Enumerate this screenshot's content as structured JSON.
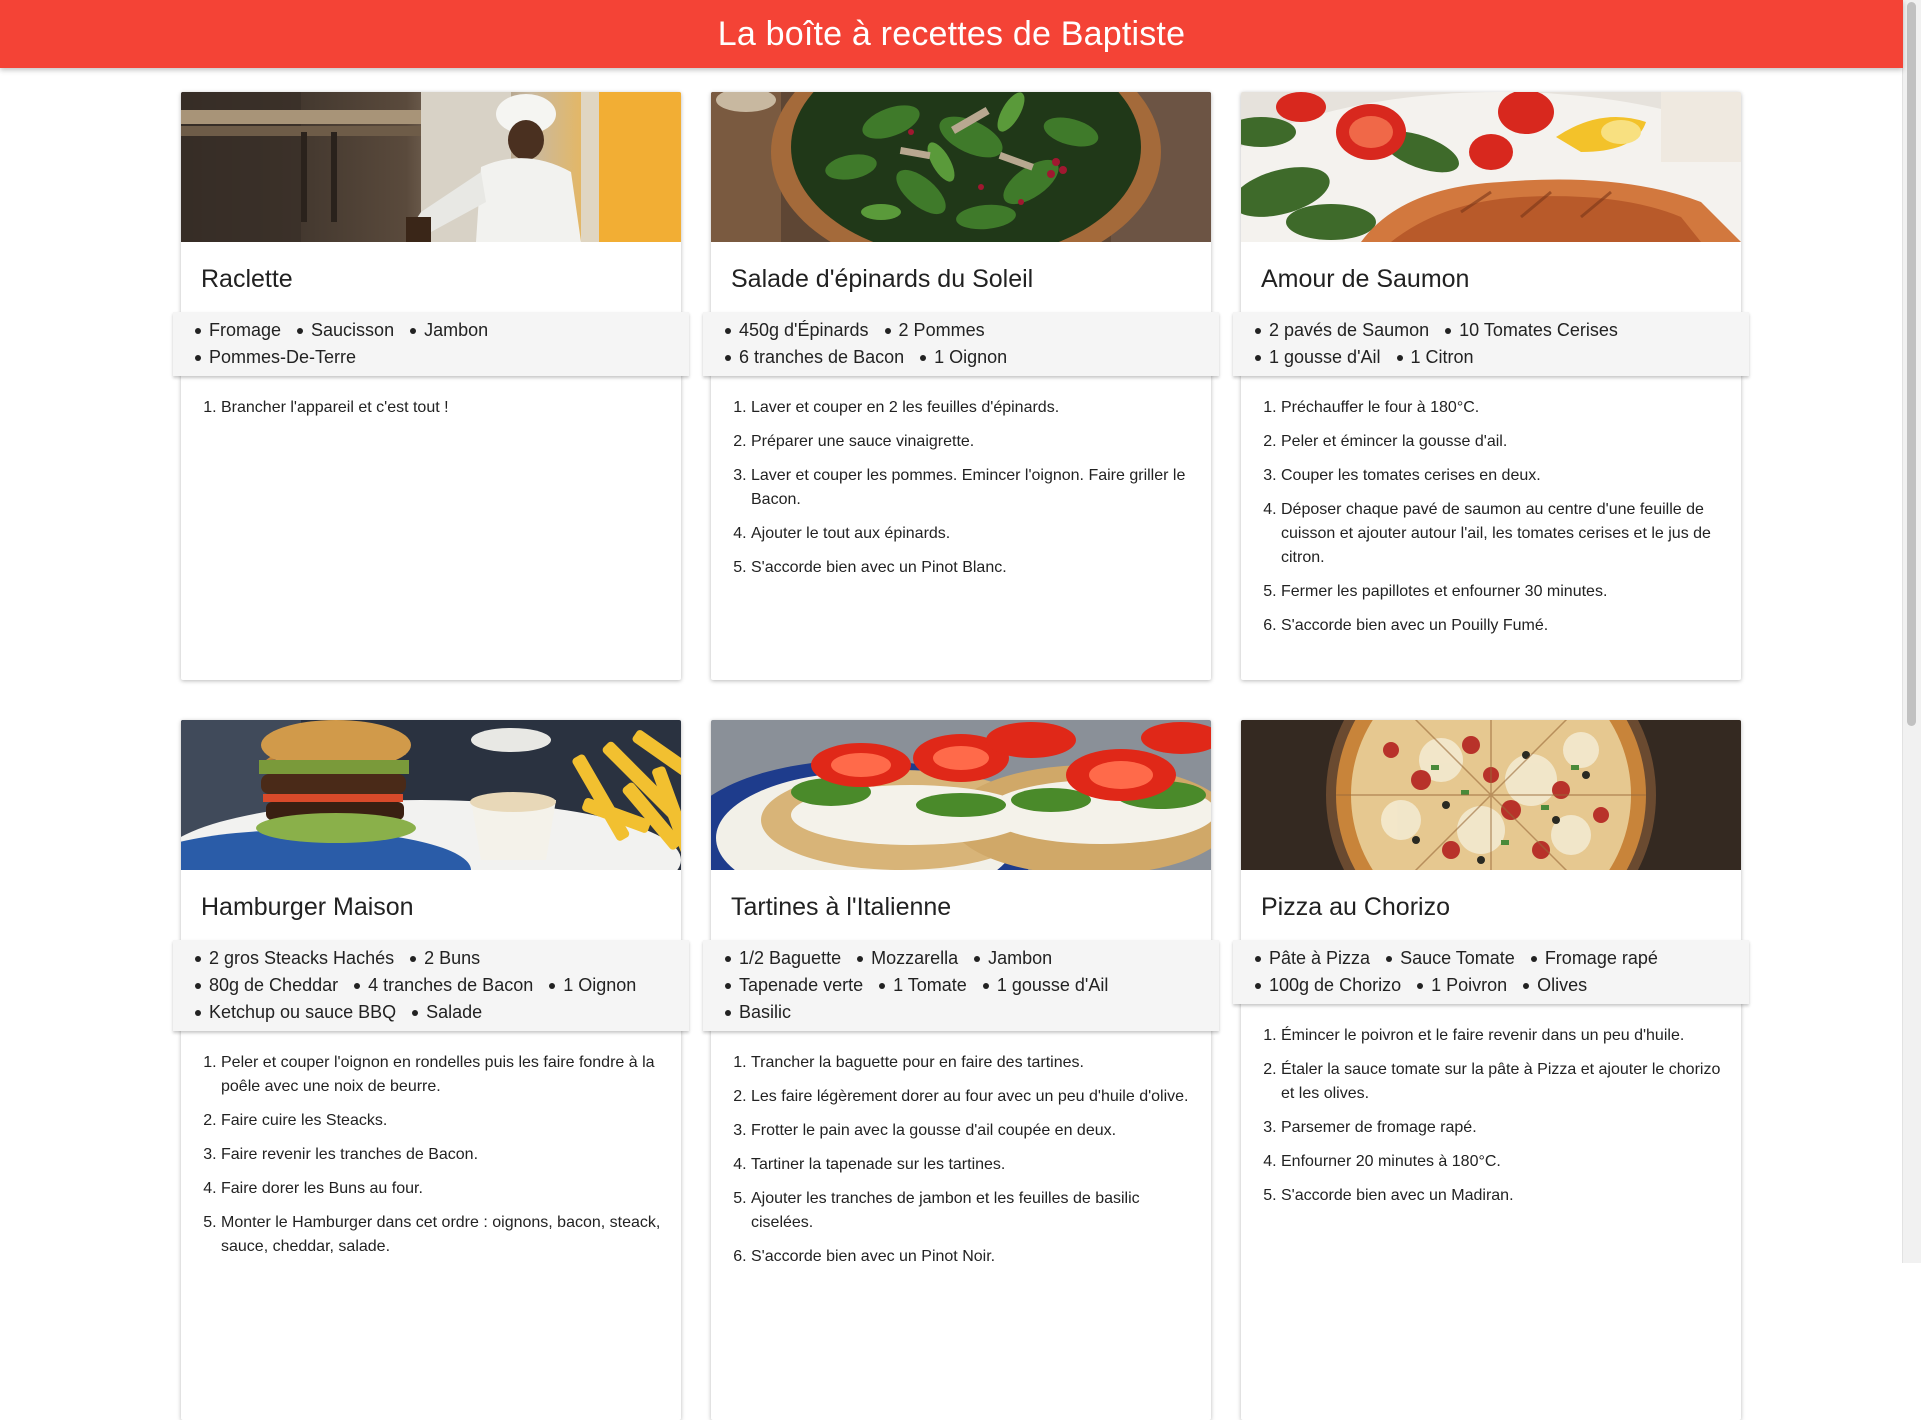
{
  "header": {
    "title": "La boîte à recettes de Baptiste"
  },
  "recipes": [
    {
      "title": "Raclette",
      "image_icon": "chef-cooking-photo",
      "ingredients": [
        "Fromage",
        "Saucisson",
        "Jambon",
        "Pommes-De-Terre"
      ],
      "steps": [
        "Brancher l'appareil et c'est tout !"
      ]
    },
    {
      "title": "Salade d'épinards du Soleil",
      "image_icon": "spinach-salad-photo",
      "ingredients": [
        "450g d'Épinards",
        "2 Pommes",
        "6 tranches de Bacon",
        "1 Oignon"
      ],
      "steps": [
        "Laver et couper en 2 les feuilles d'épinards.",
        "Préparer une sauce vinaigrette.",
        "Laver et couper les pommes. Emincer l'oignon. Faire griller le Bacon.",
        "Ajouter le tout aux épinards.",
        "S'accorde bien avec un Pinot Blanc."
      ]
    },
    {
      "title": "Amour de Saumon",
      "image_icon": "salmon-plate-photo",
      "ingredients": [
        "2 pavés de Saumon",
        "10 Tomates Cerises",
        "1 gousse d'Ail",
        "1 Citron"
      ],
      "steps": [
        "Préchauffer le four à 180°C.",
        "Peler et émincer la gousse d'ail.",
        "Couper les tomates cerises en deux.",
        "Déposer chaque pavé de saumon au centre d'une feuille de cuisson et ajouter autour l'ail, les tomates cerises et le jus de citron.",
        "Fermer les papillotes et enfourner 30 minutes.",
        "S'accorde bien avec un Pouilly Fumé."
      ]
    },
    {
      "title": "Hamburger Maison",
      "image_icon": "burger-fries-photo",
      "ingredients": [
        "2 gros Steacks Hachés",
        "2 Buns",
        "80g de Cheddar",
        "4 tranches de Bacon",
        "1 Oignon",
        "Ketchup ou sauce BBQ",
        "Salade"
      ],
      "steps": [
        "Peler et couper l'oignon en rondelles puis les faire fondre à la poêle avec une noix de beurre.",
        "Faire cuire les Steacks.",
        "Faire revenir les tranches de Bacon.",
        "Faire dorer les Buns au four.",
        "Monter le Hamburger dans cet ordre : oignons, bacon, steack, sauce, cheddar, salade."
      ]
    },
    {
      "title": "Tartines à l'Italienne",
      "image_icon": "tomato-tartines-photo",
      "ingredients": [
        "1/2 Baguette",
        "Mozzarella",
        "Jambon",
        "Tapenade verte",
        "1 Tomate",
        "1 gousse d'Ail",
        "Basilic"
      ],
      "steps": [
        "Trancher la baguette pour en faire des tartines.",
        "Les faire légèrement dorer au four avec un peu d'huile d'olive.",
        "Frotter le pain avec la gousse d'ail coupée en deux.",
        "Tartiner la tapenade sur les tartines.",
        "Ajouter les tranches de jambon et les feuilles de basilic ciselées.",
        "S'accorde bien avec un Pinot Noir."
      ]
    },
    {
      "title": "Pizza au Chorizo",
      "image_icon": "pizza-photo",
      "ingredients": [
        "Pâte à Pizza",
        "Sauce Tomate",
        "Fromage rapé",
        "100g de Chorizo",
        "1 Poivron",
        "Olives"
      ],
      "steps": [
        "Émincer le poivron et le faire revenir dans un peu d'huile.",
        "Étaler la sauce tomate sur la pâte à Pizza et ajouter le chorizo et les olives.",
        "Parsemer de fromage rapé.",
        "Enfourner 20 minutes à 180°C.",
        "S'accorde bien avec un Madiran."
      ]
    }
  ]
}
